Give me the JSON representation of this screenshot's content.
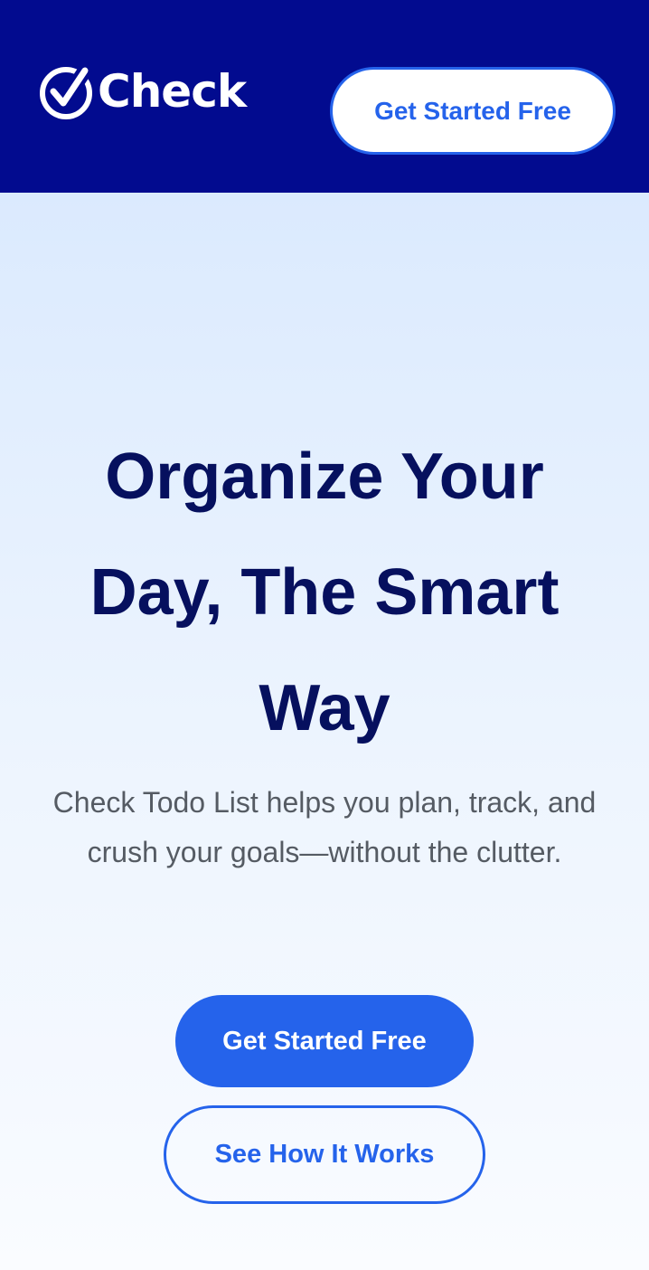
{
  "header": {
    "logo_text": "Check",
    "logo_icon": "check-circle-icon",
    "cta_label": "Get Started Free"
  },
  "hero": {
    "title": "Organize Your Day, The Smart Way",
    "subtitle": "Check Todo List helps you plan, track, and crush your goals—without the clutter.",
    "primary_button": "Get Started Free",
    "secondary_button": "See How It Works"
  },
  "colors": {
    "header_bg": "#020b8f",
    "accent": "#2563eb",
    "title": "#06105e",
    "body_text": "#555b63",
    "hero_bg_top": "#dbeafe"
  }
}
